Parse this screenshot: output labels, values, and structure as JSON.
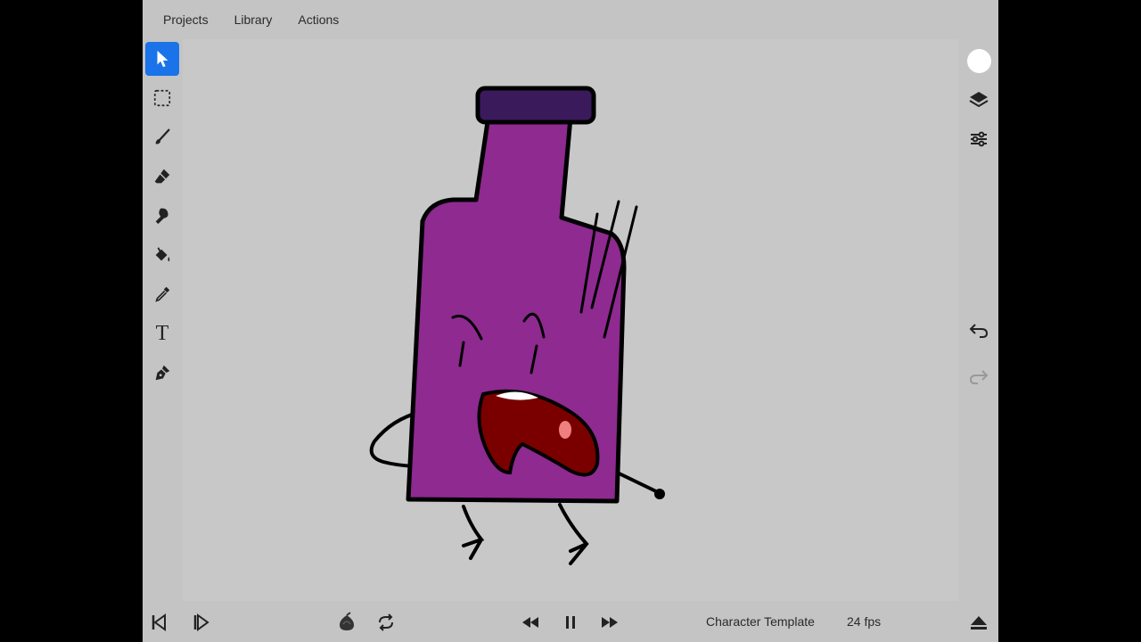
{
  "menu": {
    "projects": "Projects",
    "library": "Library",
    "actions": "Actions"
  },
  "tools": [
    {
      "icon": "pointer-icon",
      "active": true
    },
    {
      "icon": "marquee-select-icon",
      "active": false
    },
    {
      "icon": "brush-icon",
      "active": false
    },
    {
      "icon": "eraser-icon",
      "active": false
    },
    {
      "icon": "smudge-icon",
      "active": false
    },
    {
      "icon": "paint-bucket-icon",
      "active": false
    },
    {
      "icon": "eyedropper-icon",
      "active": false
    },
    {
      "icon": "text-icon",
      "active": false
    },
    {
      "icon": "pen-nib-icon",
      "active": false
    }
  ],
  "text_tool_glyph": "T",
  "right_tools": {
    "color": "#ffffff",
    "layers_icon": "layers-icon",
    "settings_icon": "sliders-icon",
    "undo_icon": "undo-icon",
    "redo_icon": "redo-icon"
  },
  "bottom": {
    "doc_title": "Character Template",
    "fps": "24 fps"
  },
  "colors": {
    "accent": "#1a73e8",
    "bottle_body": "#8e2a90",
    "bottle_cap": "#3b1a5c",
    "mouth": "#7a0000",
    "tongue": "#f08080",
    "outline": "#000000"
  }
}
